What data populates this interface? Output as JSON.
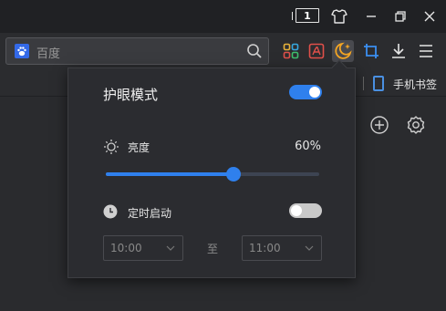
{
  "titlebar": {
    "tab_count": "1"
  },
  "address_bar": {
    "placeholder": "百度",
    "icons": [
      "baidu-logo-icon",
      "search-icon"
    ]
  },
  "toolbar": {
    "icons": [
      "apps-grid-icon",
      "pdf-icon",
      "eye-mode-moon-icon",
      "crop-icon",
      "download-icon",
      "menu-icon"
    ]
  },
  "bookmarks": {
    "phone_bookmarks_label": "手机书签"
  },
  "eye_mode_popup": {
    "title": "护眼模式",
    "enabled": true,
    "brightness": {
      "label": "亮度",
      "value_text": "60%",
      "value": 0.6
    },
    "timer": {
      "label": "定时启动",
      "enabled": false,
      "start_time": "10:00",
      "end_time": "11:00",
      "separator": "至"
    }
  },
  "colors": {
    "accent": "#2f80ed",
    "background": "#2a2b2e",
    "moon_icon": "#f5a623"
  }
}
